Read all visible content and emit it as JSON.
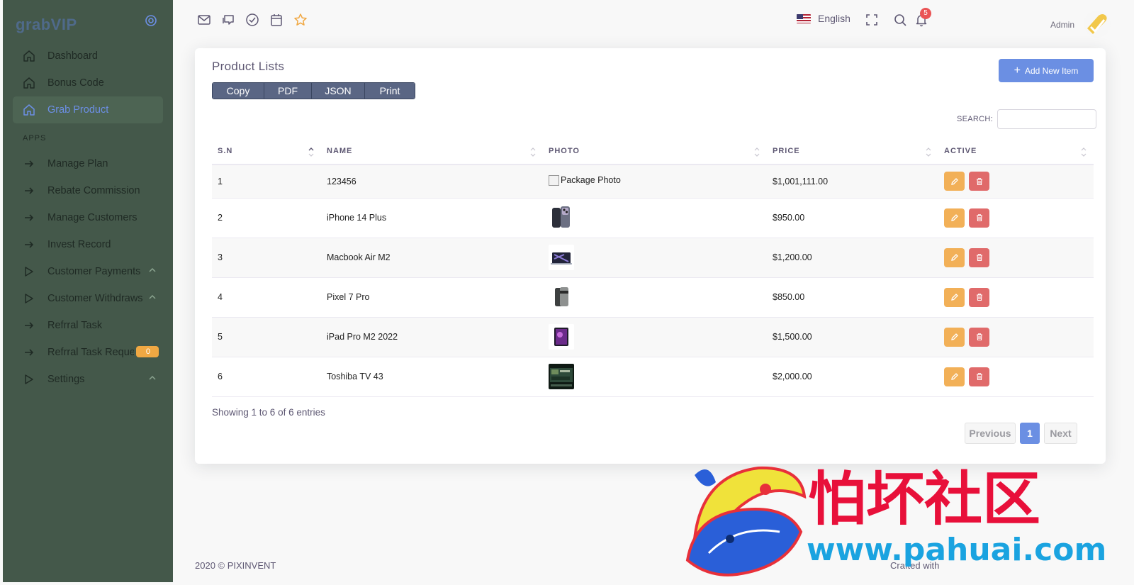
{
  "sidebar": {
    "brand": "grabVIP",
    "items": [
      {
        "label": "Dashboard",
        "icon": "home-icon"
      },
      {
        "label": "Bonus Code",
        "icon": "home-icon"
      },
      {
        "label": "Grab Product",
        "icon": "home-icon",
        "active": true
      }
    ],
    "section_title": "APPS",
    "apps": [
      {
        "label": "Manage Plan",
        "icon": "arrow-right-icon"
      },
      {
        "label": "Rebate Commission",
        "icon": "arrow-right-icon"
      },
      {
        "label": "Manage Customers",
        "icon": "arrow-right-icon"
      },
      {
        "label": "Invest Record",
        "icon": "arrow-right-icon"
      },
      {
        "label": "Customer Payments",
        "icon": "play-icon",
        "expand": true
      },
      {
        "label": "Customer Withdraws",
        "icon": "play-icon",
        "expand": true
      },
      {
        "label": "Refrral Task",
        "icon": "arrow-right-icon"
      },
      {
        "label": "Refrral Task Reque",
        "icon": "arrow-right-icon",
        "badge": "0"
      },
      {
        "label": "Settings",
        "icon": "play-icon",
        "expand": true
      }
    ]
  },
  "header": {
    "icons": [
      "mail-icon",
      "chat-icon",
      "check-circle-icon",
      "calendar-icon",
      "star-icon"
    ],
    "language": "English",
    "notification_count": "5",
    "user_name": "Admin"
  },
  "card": {
    "title": "Product Lists",
    "export_buttons": [
      "Copy",
      "PDF",
      "JSON",
      "Print"
    ],
    "add_button": "Add New Item",
    "search_label": "SEARCH:",
    "search_value": "",
    "columns": [
      "S.N",
      "NAME",
      "PHOTO",
      "PRICE",
      "ACTIVE"
    ],
    "rows": [
      {
        "sn": "1",
        "name": "123456",
        "photo": "Package Photo",
        "photo_kind": "broken",
        "price": "$1,001,111.00"
      },
      {
        "sn": "2",
        "name": "iPhone 14 Plus",
        "photo": "",
        "photo_kind": "phone",
        "price": "$950.00"
      },
      {
        "sn": "3",
        "name": "Macbook Air M2",
        "photo": "",
        "photo_kind": "laptop",
        "price": "$1,200.00"
      },
      {
        "sn": "4",
        "name": "Pixel 7 Pro",
        "photo": "",
        "photo_kind": "pixel",
        "price": "$850.00"
      },
      {
        "sn": "5",
        "name": "iPad Pro M2 2022",
        "photo": "",
        "photo_kind": "ipad",
        "price": "$1,500.00"
      },
      {
        "sn": "6",
        "name": "Toshiba TV 43",
        "photo": "",
        "photo_kind": "tv",
        "price": "$2,000.00"
      }
    ],
    "info": "Showing 1 to 6 of 6 entries",
    "pagination": {
      "previous": "Previous",
      "current": "1",
      "next": "Next"
    }
  },
  "footer": {
    "copyright": "2020 © PIXINVENT",
    "right": "Crafted with"
  },
  "watermark": {
    "cn_text": "怕坏社区",
    "url": "www.pahuai.com"
  },
  "colors": {
    "sidebar_bg": "#44584a",
    "primary": "#6b8fe3",
    "edit": "#f2b057",
    "delete": "#e06a6a"
  }
}
